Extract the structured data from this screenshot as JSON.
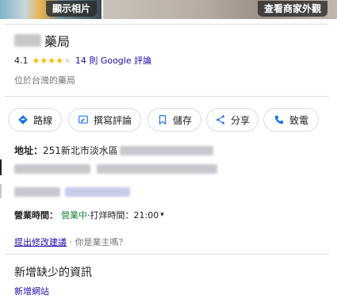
{
  "photos": {
    "show_photos_label": "顯示相片",
    "exterior_label": "查看商家外觀"
  },
  "place": {
    "name_suffix": "藥局",
    "rating": "4.1",
    "rating_value": 4.1,
    "review_count_label": "14 則 Google 評論",
    "category": "位於台灣的藥局"
  },
  "actions": [
    {
      "label": "路線",
      "icon": "directions-icon"
    },
    {
      "label": "撰寫評論",
      "icon": "write-review-icon"
    },
    {
      "label": "儲存",
      "icon": "bookmark-icon"
    },
    {
      "label": "分享",
      "icon": "share-icon"
    },
    {
      "label": "致電",
      "icon": "phone-icon"
    }
  ],
  "address": {
    "label": "地址：",
    "value_prefix": "251新北市淡水區"
  },
  "hours": {
    "label": "營業時間：",
    "status": "營業中",
    "separator": " · ",
    "closes": "打烊時間：21:00",
    "dropdown": "▾"
  },
  "suggest": {
    "edit_link": "提出修改建議",
    "separator": " · ",
    "owner_question": "你是業主嗎？"
  },
  "missing": {
    "title": "新增缺少的資訊",
    "add_website": "新增網站"
  },
  "colors": {
    "star": "#fbbc04",
    "link": "#1a0dab",
    "open_green": "#188038",
    "action_blue": "#1a73e8"
  }
}
